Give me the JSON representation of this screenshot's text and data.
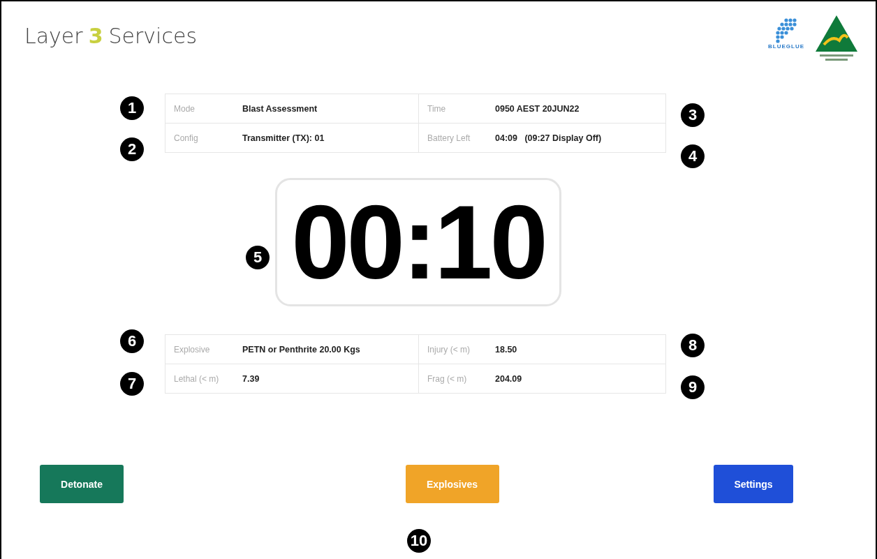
{
  "header": {
    "brand_left": "Layer",
    "brand_mark": "3",
    "brand_right": "Services",
    "partner_logo": "BLUEGLUE"
  },
  "status_table": [
    {
      "label": "Mode",
      "value": "Blast Assessment",
      "label_2": "Time",
      "value_2": "0950 AEST 20JUN22"
    },
    {
      "label": "Config",
      "value": "Transmitter (TX): 01",
      "label_2": "Battery Left",
      "value_2": "04:09   (09:27 Display Off)"
    }
  ],
  "timer": "00:10",
  "results_table": [
    {
      "label": "Explosive",
      "value": "PETN or Penthrite 20.00 Kgs",
      "label_2": "Injury (< m)",
      "value_2": "18.50"
    },
    {
      "label": "Lethal (< m)",
      "value": "7.39",
      "label_2": "Frag (< m)",
      "value_2": "204.09"
    }
  ],
  "buttons": [
    {
      "label": "Detonate",
      "kind": "detonate"
    },
    {
      "label": "Explosives",
      "kind": "explosives"
    },
    {
      "label": "Settings",
      "kind": "settings"
    }
  ],
  "callouts": [
    "1",
    "2",
    "3",
    "4",
    "5",
    "6",
    "7",
    "8",
    "9",
    "10"
  ]
}
